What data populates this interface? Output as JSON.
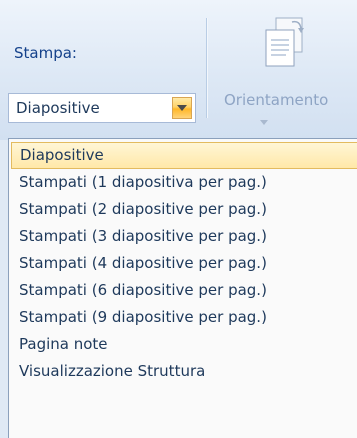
{
  "print_group": {
    "label": "Stampa:",
    "selected_value": "Diapositive"
  },
  "orientation": {
    "label": "Orientamento",
    "icon": "page-orientation-icon"
  },
  "dropdown": {
    "selected_index": 0,
    "items": [
      "Diapositive",
      "Stampati (1 diapositiva per pag.)",
      "Stampati (2 diapositive per pag.)",
      "Stampati (3 diapositive per pag.)",
      "Stampati (4 diapositive per pag.)",
      "Stampati (6 diapositive per pag.)",
      "Stampati (9 diapositive per pag.)",
      "Pagina note",
      "Visualizzazione Struttura"
    ]
  },
  "colors": {
    "ribbon_text": "#15428b",
    "highlight_bg": "#ffe8a8",
    "highlight_border": "#e3bb5f"
  }
}
